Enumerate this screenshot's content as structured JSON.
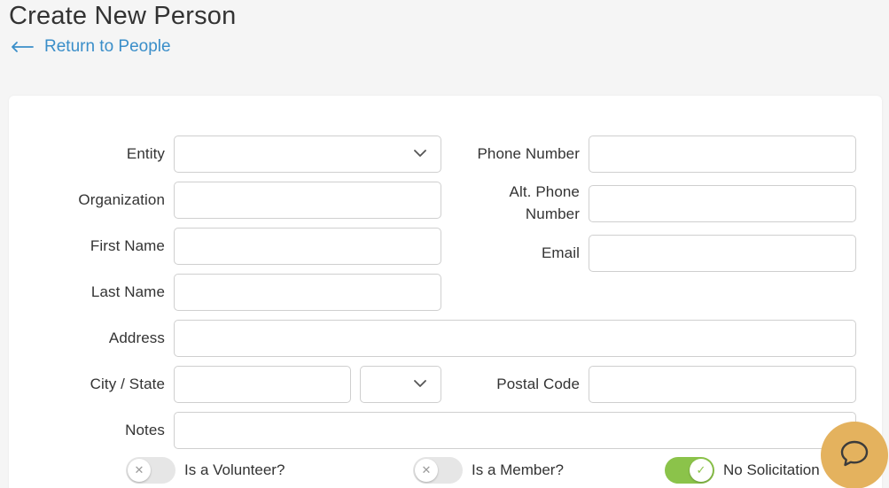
{
  "header": {
    "title": "Create New Person",
    "back_link": "Return to People"
  },
  "form": {
    "entity": {
      "label": "Entity",
      "value": ""
    },
    "organization": {
      "label": "Organization",
      "value": ""
    },
    "first_name": {
      "label": "First Name",
      "value": ""
    },
    "last_name": {
      "label": "Last Name",
      "value": ""
    },
    "phone": {
      "label": "Phone Number",
      "value": ""
    },
    "alt_phone": {
      "label_line1": "Alt. Phone",
      "label_line2": "Number",
      "value": ""
    },
    "email": {
      "label": "Email",
      "value": ""
    },
    "address": {
      "label": "Address",
      "value": ""
    },
    "city_state": {
      "label": "City / State",
      "city_value": "",
      "state_value": ""
    },
    "postal_code": {
      "label": "Postal Code",
      "value": ""
    },
    "notes": {
      "label": "Notes",
      "value": ""
    }
  },
  "toggles": [
    {
      "label": "Is a Volunteer?",
      "on": false
    },
    {
      "label": "Is a Member?",
      "on": false
    },
    {
      "label": "No Solicitation",
      "on": true
    }
  ],
  "icons": {
    "back": "arrow-left-icon",
    "select": "chevron-down-icon",
    "toggle_off": "x-icon",
    "toggle_on": "check-icon",
    "chat": "chat-bubble-icon"
  },
  "colors": {
    "link": "#3a8ec9",
    "toggle_on": "#8bc34a",
    "chat_button": "#e4b25e"
  }
}
